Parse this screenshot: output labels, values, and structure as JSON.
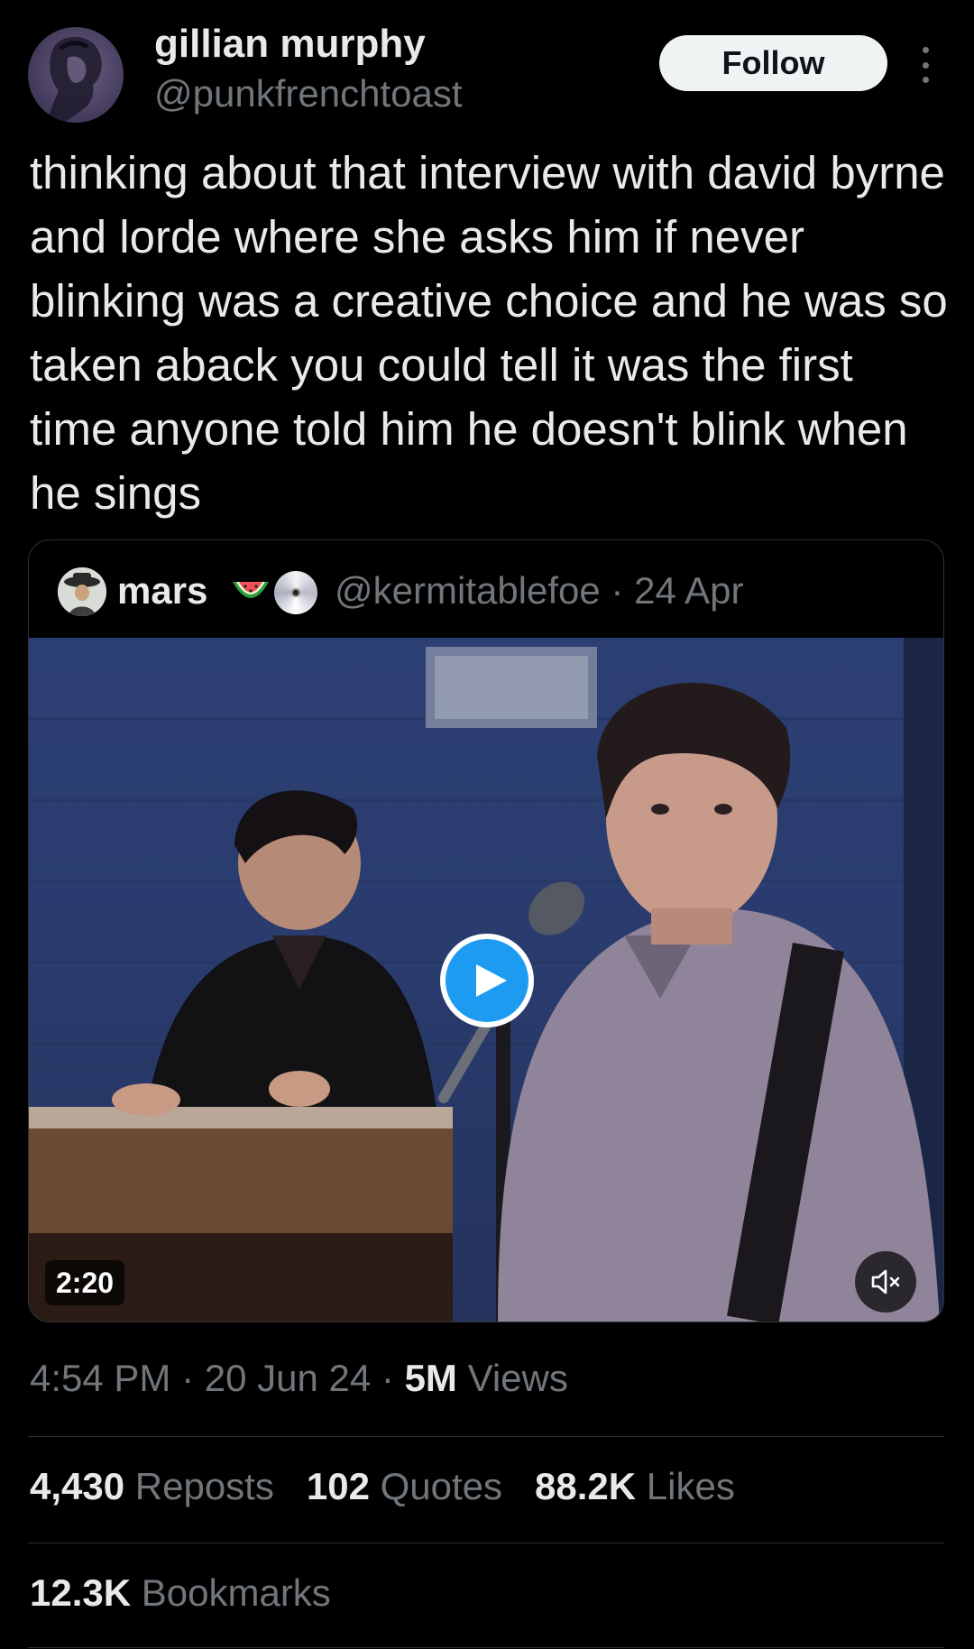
{
  "author": {
    "display_name": "gillian murphy",
    "handle": "@punkfrenchtoast",
    "avatar_icon": "portrait-avatar"
  },
  "follow_label": "Follow",
  "more_icon": "vertical-ellipsis-icon",
  "tweet_text": "thinking about that interview with david byrne and lorde where she asks him if never blinking was a creative choice and he was so taken aback you could tell it was the first time anyone told him he doesn't blink when he sings",
  "quoted_post": {
    "display_name": "mars",
    "emoji": [
      "watermelon",
      "optical-disc"
    ],
    "handle_date": "@kermitablefoe · 24 Apr",
    "video": {
      "duration": "2:20",
      "play_icon": "play-icon",
      "mute_icon": "speaker-muted-icon"
    }
  },
  "meta": {
    "time_date": "4:54 PM · 20 Jun 24 · ",
    "views_count": "5M",
    "views_label": " Views"
  },
  "stats": {
    "reposts_count": "4,430",
    "reposts_label": " Reposts",
    "quotes_count": "102",
    "quotes_label": " Quotes",
    "likes_count": "88.2K",
    "likes_label": " Likes",
    "bookmarks_count": "12.3K",
    "bookmarks_label": " Bookmarks"
  },
  "colors": {
    "background": "#000000",
    "text_primary": "#e7e9ea",
    "text_secondary": "#71767b",
    "divider": "#2f3336",
    "accent": "#1d9bf0"
  }
}
